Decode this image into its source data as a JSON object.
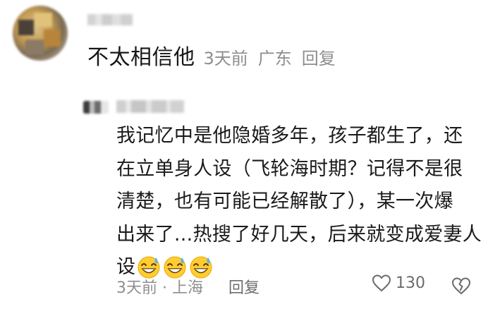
{
  "comment": {
    "text": "不太相信他",
    "time": "3天前",
    "location": "广东",
    "reply_label": "回复"
  },
  "reply": {
    "lines": [
      "我记忆中是他隐婚多年，孩子都生了，还",
      "在立单身人设（飞轮海时期？记得不是很",
      "清楚，也有可能已经解散了），某一次爆",
      "出来了...热搜了好几天，后来就变成爱妻人",
      "设"
    ],
    "emojis": [
      "grinning-sweat-emoji",
      "grinning-sweat-emoji",
      "grinning-sweat-emoji"
    ],
    "time_location": "3天前 · 上海",
    "reply_label": "回复",
    "like_count": "130"
  },
  "icons": {
    "like": "heart-outline-icon",
    "dislike": "broken-heart-outline-icon"
  },
  "colors": {
    "text_primary": "#1a1a1a",
    "text_meta": "#8e8e8e",
    "background": "#ffffff"
  }
}
